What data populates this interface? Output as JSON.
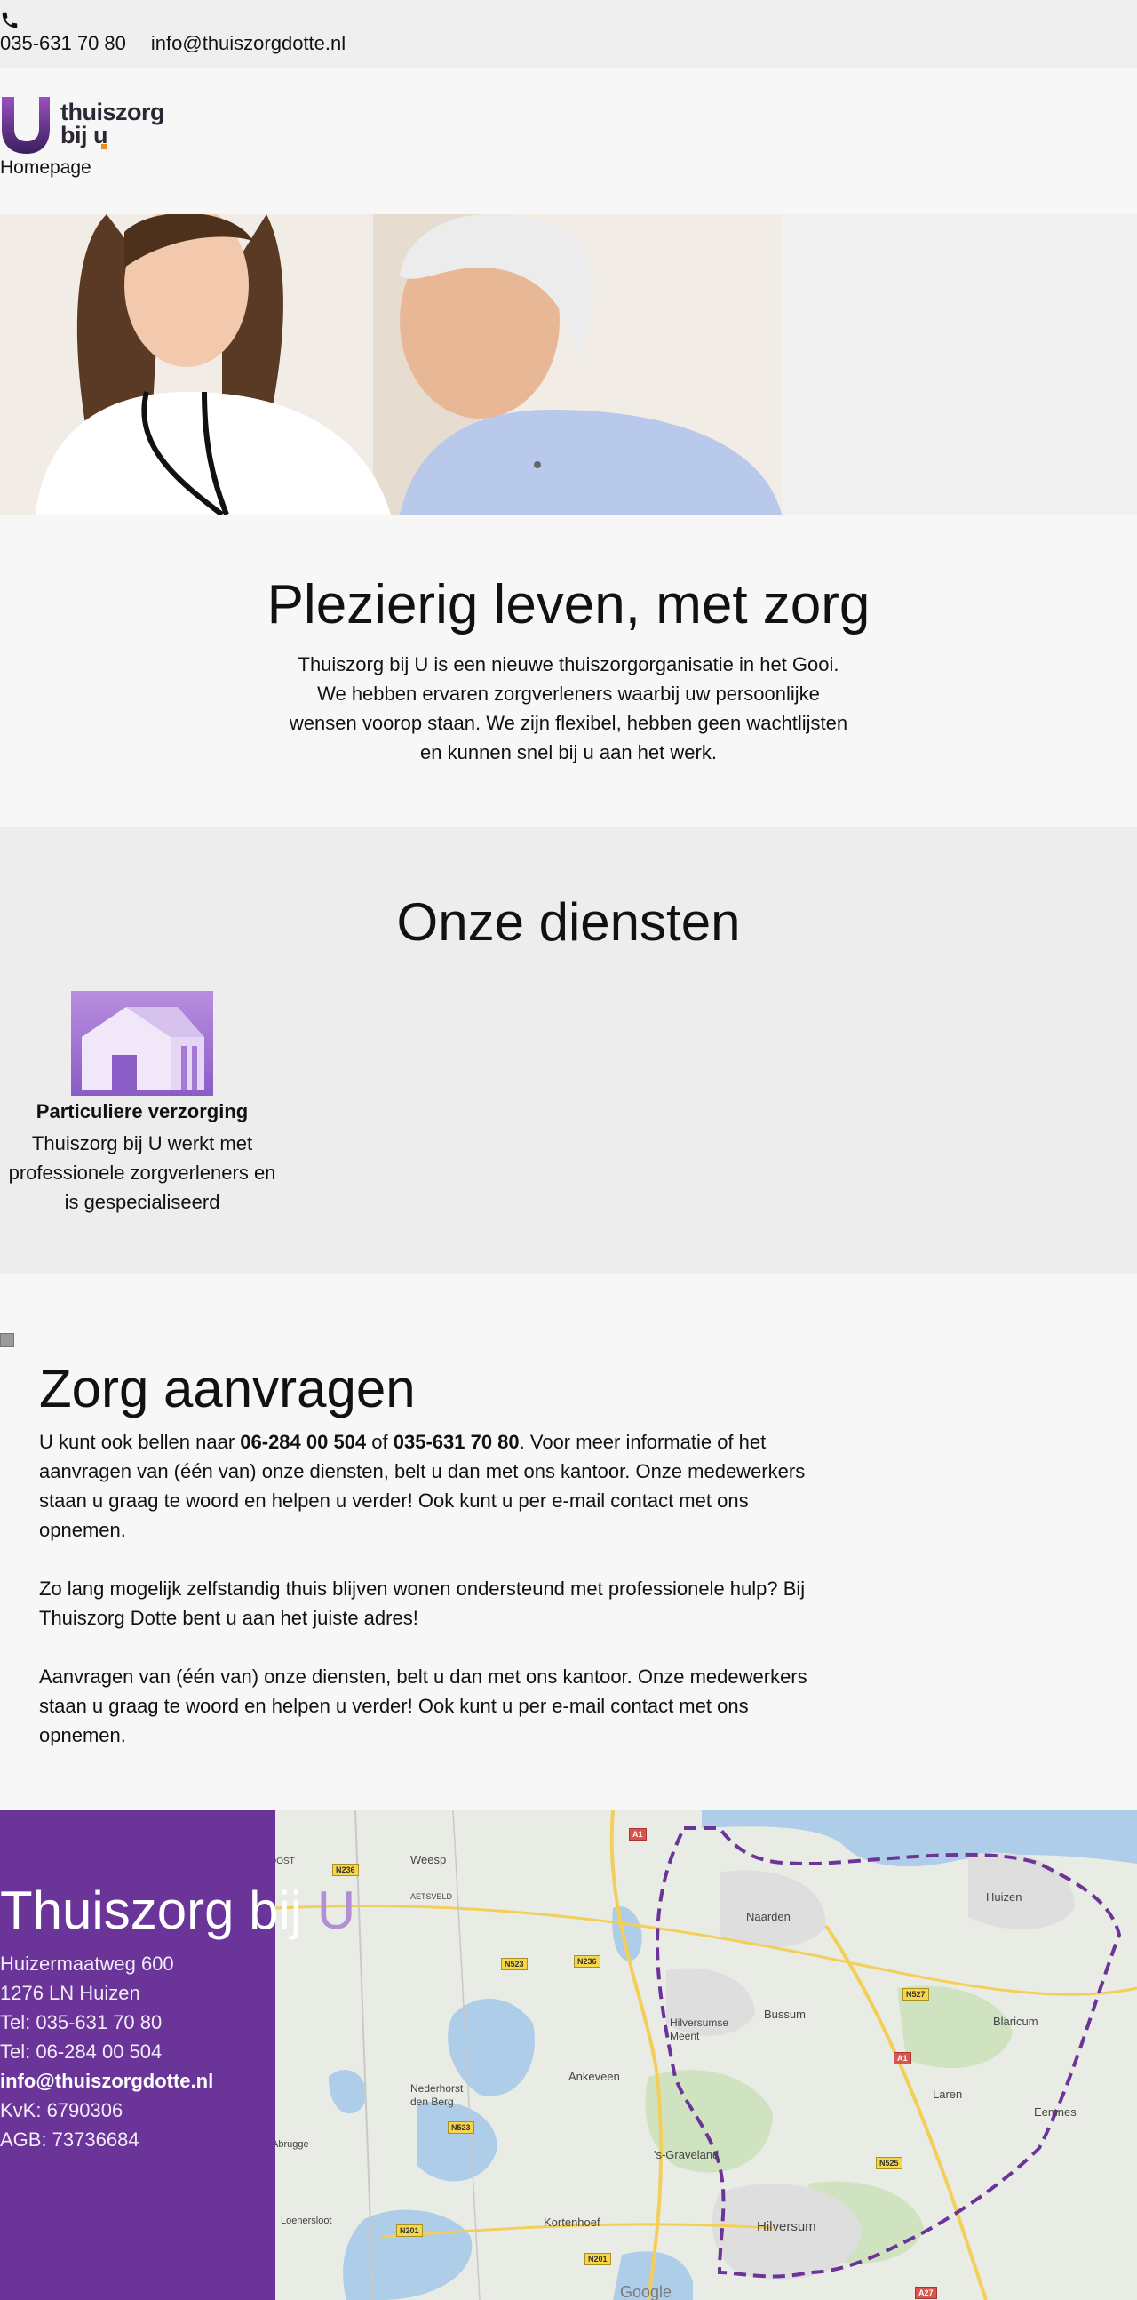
{
  "topbar": {
    "phone": "035-631 70 80",
    "email": "info@thuiszorgdotte.nl",
    "icon": "phone-icon"
  },
  "header": {
    "logo_line1": "thuiszorg",
    "logo_line2": "bij u",
    "nav_home": "Homepage",
    "brand_color": "#6a3499"
  },
  "intro": {
    "title": "Plezierig leven, met zorg",
    "text": "Thuiszorg bij U is een nieuwe thuiszorgorganisatie in het Gooi. We hebben ervaren zorgverleners waarbij uw persoonlijke wensen voorop staan. We zijn flexibel, hebben geen wachtlijsten en kunnen snel bij u aan het werk."
  },
  "services": {
    "title": "Onze diensten",
    "items": [
      {
        "icon": "house-icon",
        "title": "Particuliere verzorging",
        "description": "Thuiszorg bij U werkt met professionele zorgverleners en is gespecialiseerd"
      }
    ]
  },
  "request": {
    "title": "Zorg aanvragen",
    "p1_before": "U kunt ook bellen naar ",
    "p1_num1": "06-284 00 504",
    "p1_mid": " of ",
    "p1_num2": "035-631 70 80",
    "p1_after": ". Voor meer informatie of het aanvragen van (één van) onze diensten, belt u dan met ons kantoor. Onze medewerkers staan u graag te woord en helpen u verder! Ook kunt u per e-mail contact met ons opnemen.",
    "p2": "Zo lang mogelijk zelfstandig thuis blijven wonen ondersteund met professionele hulp? Bij Thuiszorg Dotte bent u aan het juiste adres!",
    "p3": "Aanvragen van (één van) onze diensten, belt u dan met ons kantoor. Onze medewerkers staan u graag te woord en helpen u verder! Ook kunt u per e-mail contact met ons opnemen."
  },
  "footer": {
    "title_main": "Thuiszorg bij ",
    "title_faint": "U",
    "address1": "Huizermaatweg 600",
    "address2": "1276 LN Huizen",
    "tel1": "Tel: 035-631 70 80",
    "tel2": "Tel: 06-284 00 504",
    "email": "info@thuiszorgdotte.nl",
    "kvk": "KvK: 6790306",
    "agb": "AGB: 73736684"
  },
  "map": {
    "places": [
      "Weesp",
      "Naarden",
      "Huizen",
      "Bussum",
      "Hilversumse Meent",
      "Blaricum",
      "Ankeveen",
      "Nederhorst den Berg",
      "Laren",
      "Eemnes",
      "'s-Graveland",
      "Kortenhoef",
      "Hilversum",
      "Loenersloot",
      "AETSVELD",
      "DOST",
      "Abrugge"
    ],
    "roads": [
      "A1",
      "N236",
      "N523",
      "N236",
      "N527",
      "A1",
      "N523",
      "N525",
      "N201",
      "N201",
      "A27"
    ],
    "attribution": "Google",
    "area_color": "#6a3499"
  }
}
